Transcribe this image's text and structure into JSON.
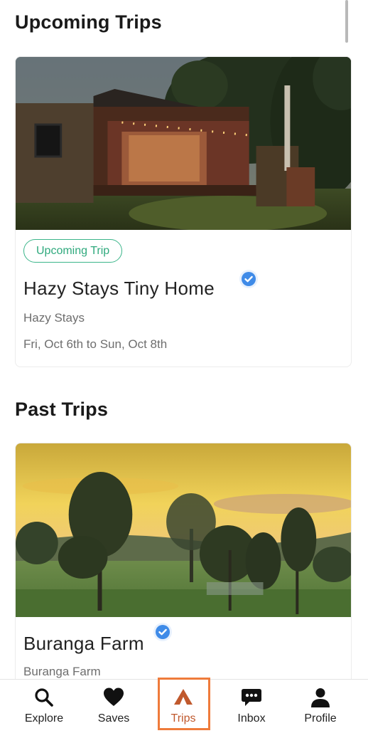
{
  "sections": {
    "upcoming_title": "Upcoming Trips",
    "past_title": "Past Trips"
  },
  "upcoming": {
    "badge": "Upcoming Trip",
    "name": "Hazy Stays Tiny Home",
    "host": "Hazy Stays",
    "dates": "Fri, Oct 6th to Sun, Oct 8th",
    "verified": true
  },
  "past": {
    "name": "Buranga Farm",
    "host": "Buranga Farm",
    "verified": true
  },
  "tabbar": {
    "items": [
      {
        "label": "Explore",
        "icon": "search-icon"
      },
      {
        "label": "Saves",
        "icon": "heart-icon"
      },
      {
        "label": "Trips",
        "icon": "tent-icon"
      },
      {
        "label": "Inbox",
        "icon": "chat-bubble-icon"
      },
      {
        "label": "Profile",
        "icon": "person-icon"
      }
    ],
    "active": "Trips"
  },
  "colors": {
    "accent": "#c0592d",
    "badge_green": "#2fa97d",
    "verified_blue": "#3f8be8"
  }
}
